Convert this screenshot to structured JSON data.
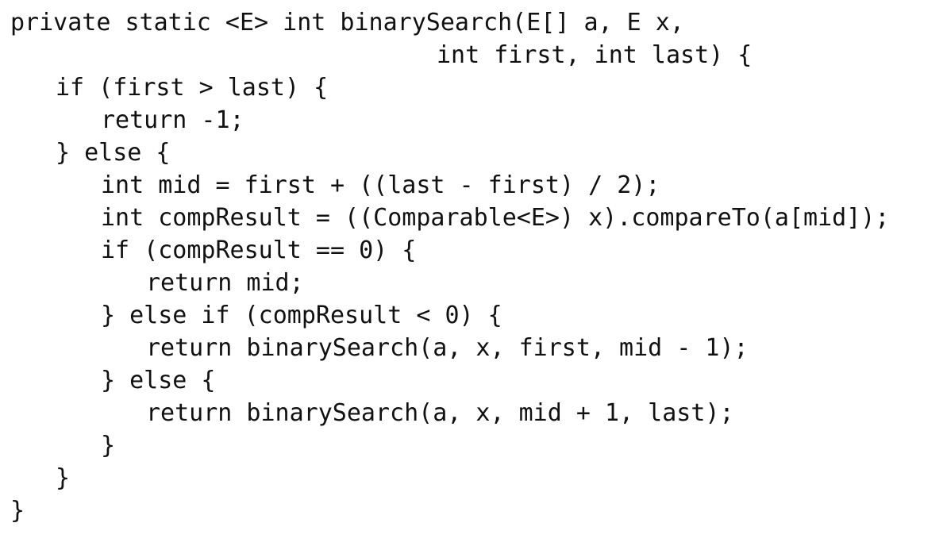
{
  "code": {
    "lines": [
      "private static <E> int binarySearch(E[] a, E x,",
      "int first, int last) {",
      "if (first > last) {",
      "return -1;",
      "} else {",
      "int mid = first + ((last - first) / 2);",
      "int compResult = ((Comparable<E>) x).compareTo(a[mid]);",
      "if (compResult == 0) {",
      "return mid;",
      "} else if (compResult < 0) {",
      "return binarySearch(a, x, first, mid - 1);",
      "} else {",
      "return binarySearch(a, x, mid + 1, last);",
      "}",
      "}",
      "}"
    ]
  }
}
